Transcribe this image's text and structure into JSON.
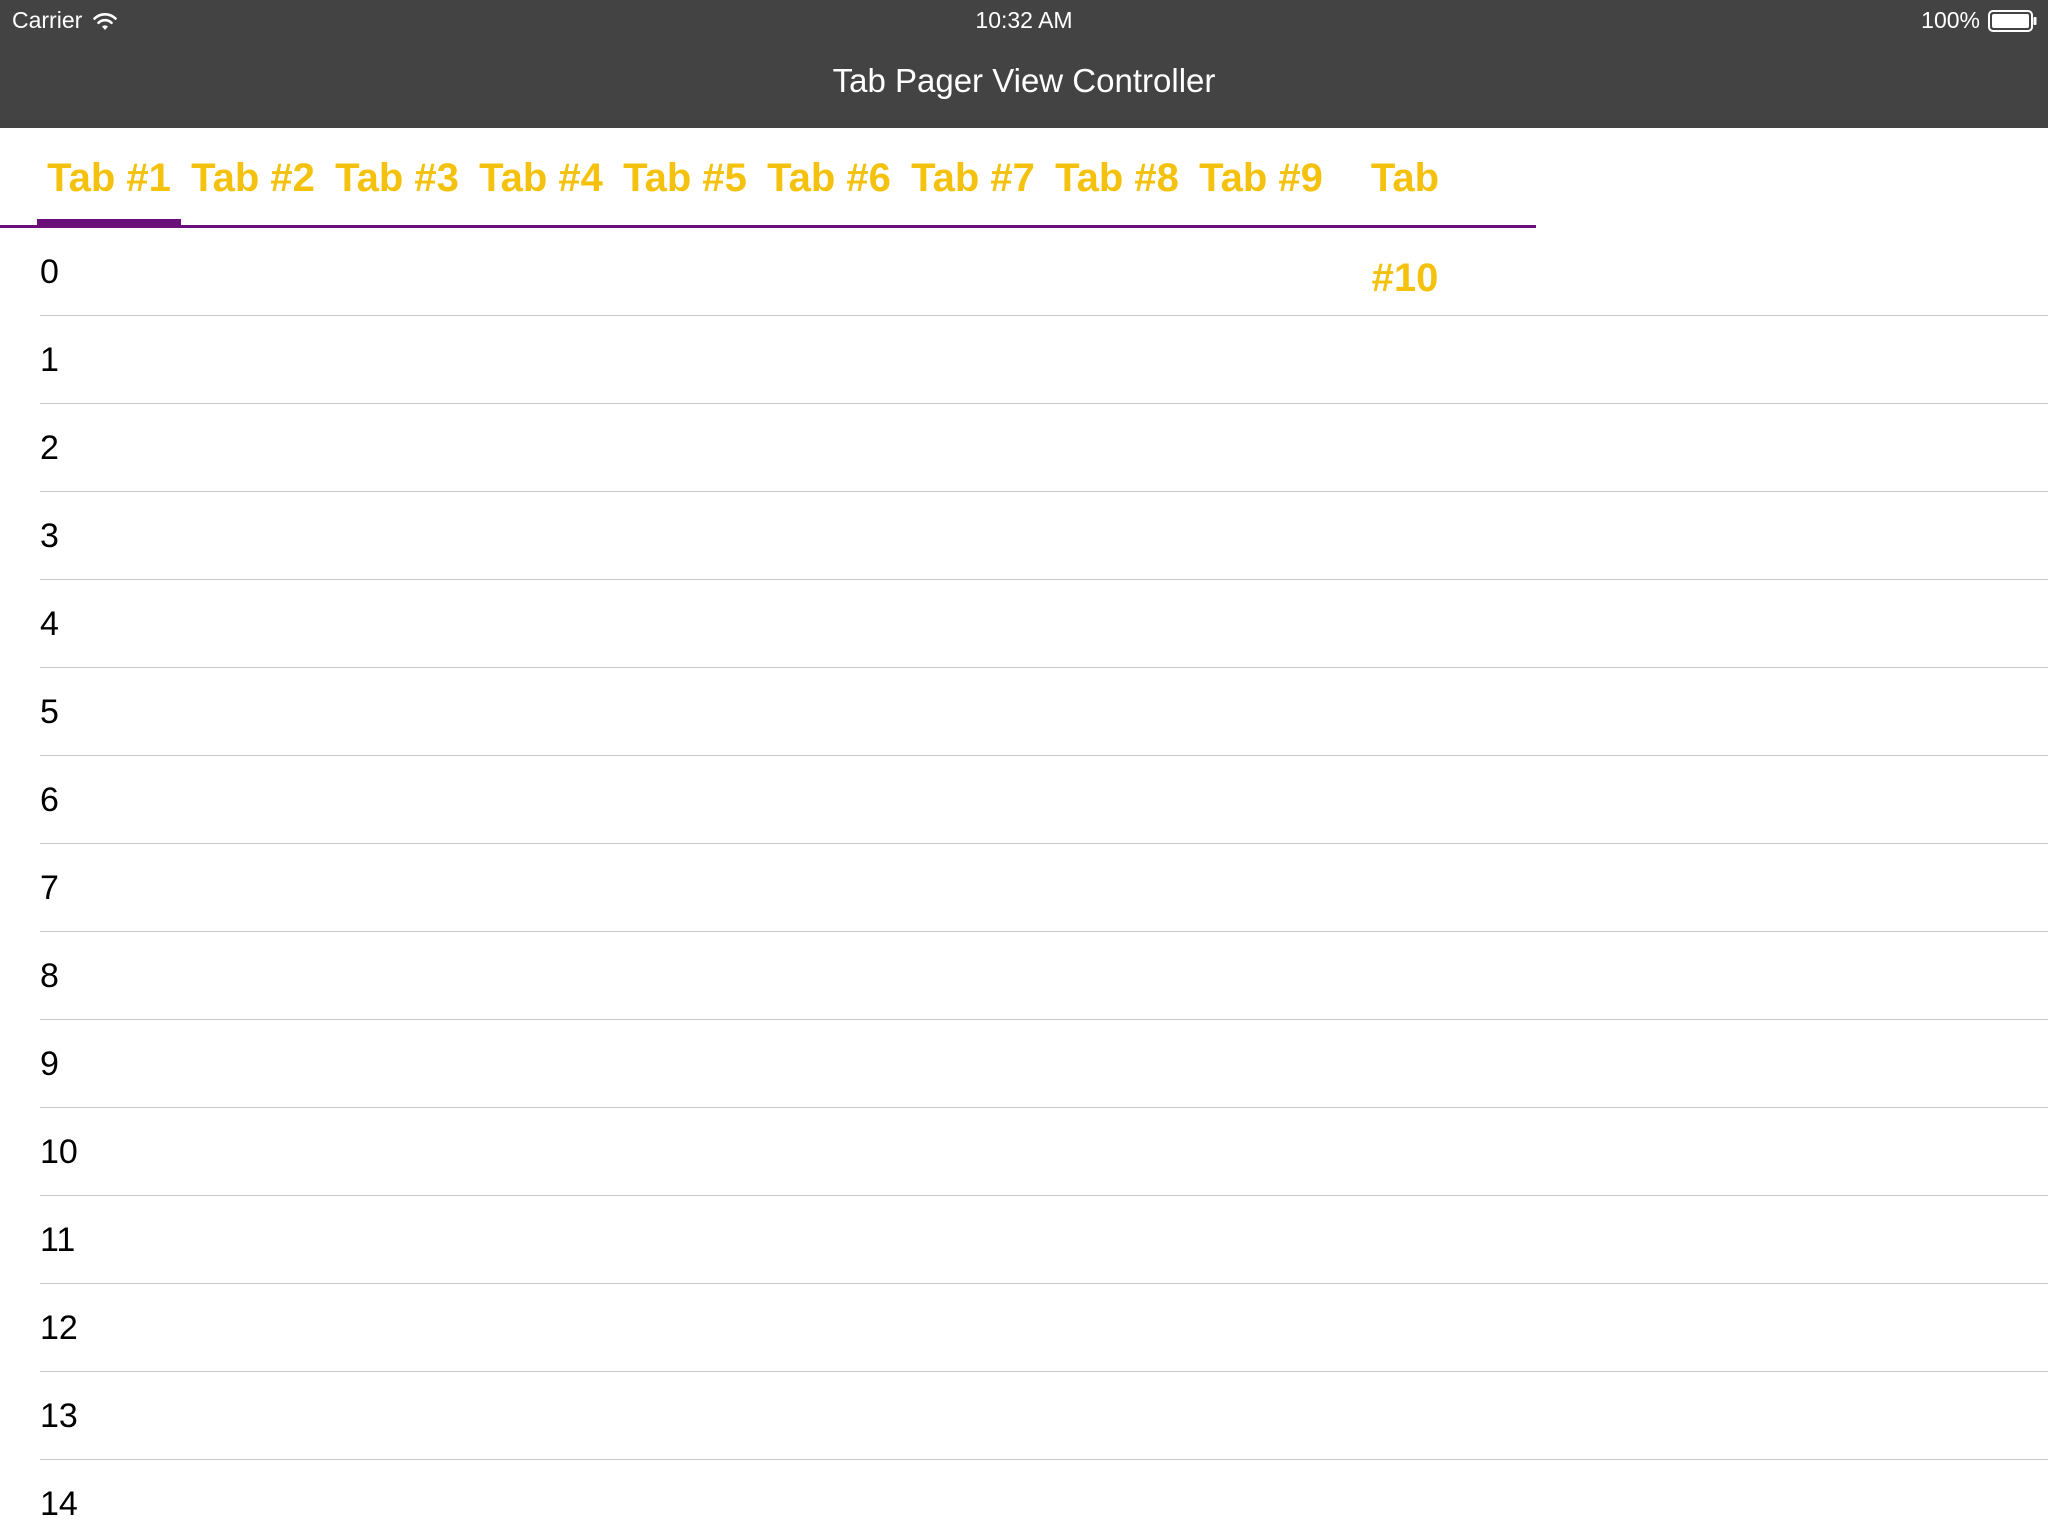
{
  "status_bar": {
    "carrier": "Carrier",
    "time": "10:32 AM",
    "battery": "100%"
  },
  "nav": {
    "title": "Tab Pager View Controller"
  },
  "tabs": [
    {
      "label": "Tab #1",
      "selected": true
    },
    {
      "label": "Tab #2",
      "selected": false
    },
    {
      "label": "Tab #3",
      "selected": false
    },
    {
      "label": "Tab #4",
      "selected": false
    },
    {
      "label": "Tab #5",
      "selected": false
    },
    {
      "label": "Tab #6",
      "selected": false
    },
    {
      "label": "Tab #7",
      "selected": false
    },
    {
      "label": "Tab #8",
      "selected": false
    },
    {
      "label": "Tab #9",
      "selected": false
    },
    {
      "label": "Tab #10",
      "selected": false
    }
  ],
  "list": {
    "rows": [
      "0",
      "1",
      "2",
      "3",
      "4",
      "5",
      "6",
      "7",
      "8",
      "9",
      "10",
      "11",
      "12",
      "13",
      "14"
    ]
  },
  "colors": {
    "header_bg": "#434343",
    "tab_text": "#f4c20d",
    "tab_indicator": "#6b0f7a",
    "separator": "#c8c7cc"
  },
  "icons": {
    "wifi": "wifi-icon",
    "battery": "battery-icon"
  }
}
